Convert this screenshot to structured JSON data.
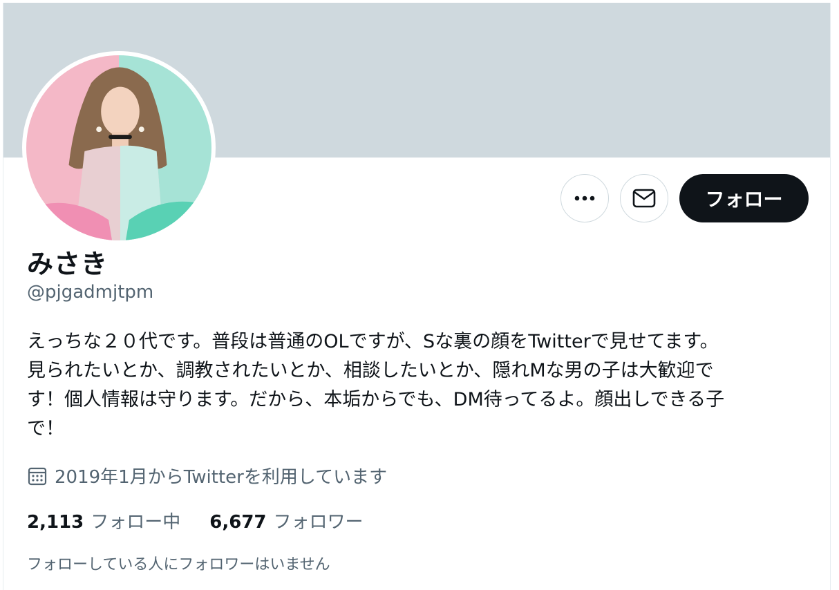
{
  "profile": {
    "display_name": "みさき",
    "handle": "@pjgadmjtpm",
    "bio": "えっちな２０代です。普段は普通のOLですが、Sな裏の顔をTwitterで見せてます。\n見られたいとか、調教されたいとか、相談したいとか、隠れMな男の子は大歓迎で\nす！個人情報は守ります。だから、本垢からでも、DM待ってるよ。顔出しできる子\nで！",
    "joined": "2019年1月からTwitterを利用しています",
    "following_count": "2,113",
    "following_label": "フォロー中",
    "followers_count": "6,677",
    "followers_label": "フォロワー",
    "followed_by_note": "フォローしている人にフォロワーはいません"
  },
  "actions": {
    "more_icon": "more-dots-icon",
    "message_icon": "envelope-icon",
    "follow_label": "フォロー"
  },
  "colors": {
    "banner": "#cfd9de",
    "text_primary": "#0f1419",
    "text_secondary": "#536471",
    "follow_button_bg": "#0f1419",
    "avatar_left": "#f4b8c7",
    "avatar_right": "#a6e3d6"
  }
}
